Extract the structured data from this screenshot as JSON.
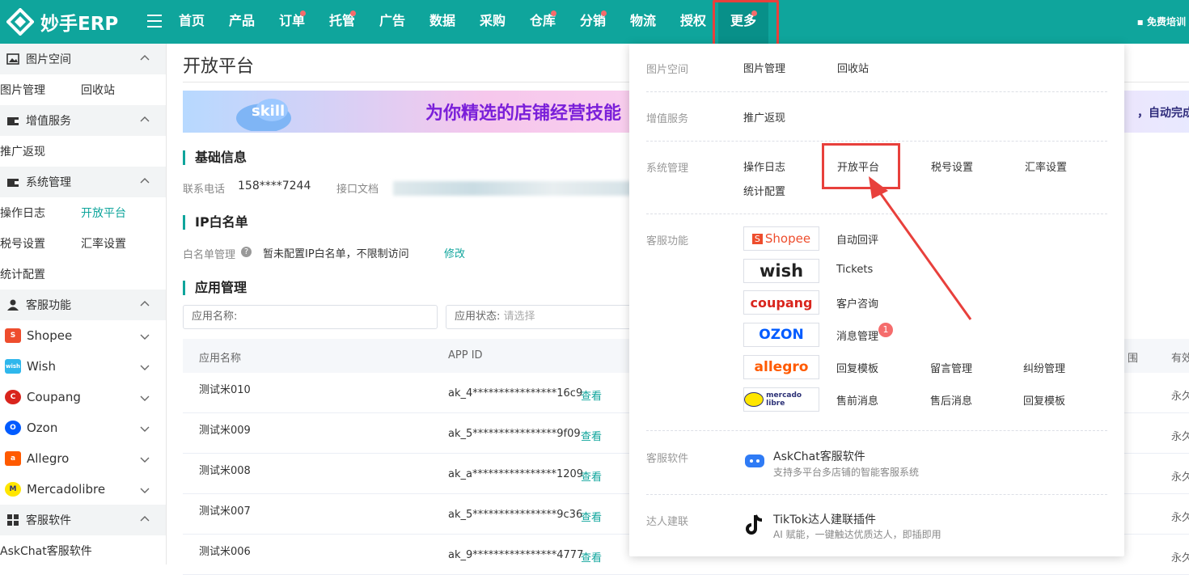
{
  "topbar": {
    "logo_text": "妙手ERP",
    "nav": [
      "首页",
      "产品",
      "订单",
      "托管",
      "广告",
      "数据",
      "采购",
      "仓库",
      "分销",
      "物流",
      "授权",
      "更多"
    ],
    "nav_dots": [
      false,
      false,
      true,
      true,
      false,
      false,
      false,
      true,
      true,
      false,
      false,
      true
    ],
    "train": "免费培训",
    "accent": "#0fa59c",
    "highlight_color": "#e8403c"
  },
  "sidebar": {
    "sec_image": "图片空间",
    "image_items": [
      "图片管理",
      "回收站"
    ],
    "sec_value": "增值服务",
    "value_items": [
      "推广返现"
    ],
    "sec_system": "系统管理",
    "system_row1": [
      "操作日志",
      "开放平台"
    ],
    "system_row2": [
      "税号设置",
      "汇率设置"
    ],
    "system_row3": [
      "统计配置"
    ],
    "sec_cs": "客服功能",
    "platforms": [
      "Shopee",
      "Wish",
      "Coupang",
      "Ozon",
      "Allegro",
      "Mercadolibre"
    ],
    "sec_soft": "客服软件",
    "soft_items": [
      "AskChat客服软件"
    ]
  },
  "main": {
    "title": "开放平台",
    "banner_left": "为你精选的店铺经营技能",
    "banner_right": "，自动完成",
    "banner_skill": "skill",
    "basic_header": "基础信息",
    "phone_label": "联系电话",
    "phone_value": "158****7244",
    "doc_label": "接口文档",
    "ip_header": "IP白名单",
    "ip_label": "白名单管理",
    "ip_value": "暂未配置IP白名单，不限制访问",
    "ip_edit": "修改",
    "app_header": "应用管理",
    "filter_name": "应用名称:",
    "filter_status_label": "应用状态:",
    "filter_status_placeholder": "请选择",
    "col_name": "应用名称",
    "col_appid": "APP ID",
    "col_range": "围",
    "col_valid": "有效",
    "view_label": "查看",
    "forever": "永久",
    "rows": [
      {
        "name": "测试米010",
        "appid": "ak_4****************16c9"
      },
      {
        "name": "测试米009",
        "appid": "ak_5****************9f09"
      },
      {
        "name": "测试米008",
        "appid": "ak_a****************1209"
      },
      {
        "name": "测试米007",
        "appid": "ak_5****************9c36"
      },
      {
        "name": "测试米006",
        "appid": "ak_9****************4777"
      }
    ]
  },
  "popup": {
    "image_label": "图片空间",
    "image_items": [
      "图片管理",
      "回收站"
    ],
    "value_label": "增值服务",
    "value_items": [
      "推广返现"
    ],
    "system_label": "系统管理",
    "system_items": [
      "操作日志",
      "开放平台",
      "税号设置",
      "汇率设置",
      "统计配置"
    ],
    "cs_label": "客服功能",
    "shopee_logo": "Shopee",
    "wish_logo": "wish",
    "coupang_logo": "coupang",
    "ozon_logo": "OZON",
    "allegro_logo": "allegro",
    "mercado_logo": "mercado libre",
    "shopee_items": [
      "自动回评"
    ],
    "wish_items": [
      "Tickets"
    ],
    "coupang_items": [
      "客户咨询"
    ],
    "ozon_items": [
      "消息管理"
    ],
    "ozon_badge": "1",
    "allegro_items": [
      "回复模板",
      "留言管理",
      "纠纷管理"
    ],
    "mercado_items": [
      "售前消息",
      "售后消息",
      "回复模板"
    ],
    "soft_label": "客服软件",
    "askchat_title": "AskChat客服软件",
    "askchat_desc": "支持多平台多店铺的智能客服系统",
    "influencer_label": "达人建联",
    "tiktok_title": "TikTok达人建联插件",
    "tiktok_desc": "AI 赋能，一键触达优质达人，即插即用"
  }
}
